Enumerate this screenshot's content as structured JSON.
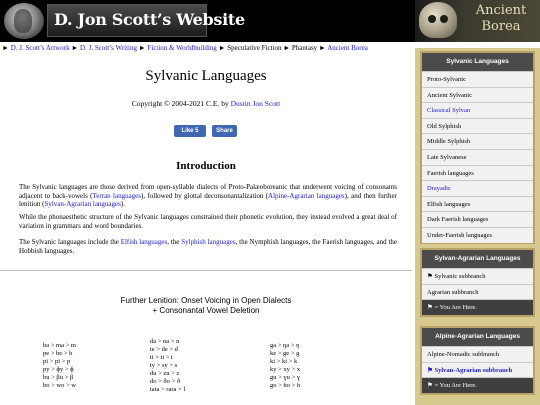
{
  "header": {
    "site_title": "D. Jon Scott’s Website",
    "banner_line1": "Ancient",
    "banner_line2": "Borea"
  },
  "breadcrumb": [
    {
      "label": "D. J. Scott’s Artwork",
      "link": true
    },
    {
      "label": "D. J. Scott’s Writing",
      "link": true
    },
    {
      "label": "Fiction & Worldbuilding",
      "link": true
    },
    {
      "label": "Speculative Fiction",
      "link": false
    },
    {
      "label": "Phantasy",
      "link": false
    },
    {
      "label": "Ancient Borea",
      "link": true
    }
  ],
  "main": {
    "title": "Sylvanic Languages",
    "copyright_prefix": "Copyright © 2004-2021 C.E. by",
    "copyright_author": "Dustin Jon Scott",
    "fb_like": "Like 5",
    "fb_share": "Share",
    "intro_heading": "Introduction",
    "p1": {
      "t1": "The Sylvanic languages are those derived from open-syllable dialects of Proto-Palæoboreanic that underwent voicing of consonants adjacent to back-vowels (",
      "l1": "Terran languages",
      "t2": "), followed by glottal deconsonantalization (",
      "l2": "Alpine-Agrarian languages",
      "t3": "), and then further lenition (",
      "l3": "Sylvan-Agrarian languages",
      "t4": ")."
    },
    "p2": "While the phonaesthetic structure of the Sylvanic languages constrained their phonetic evolution, they instead evolved a great deal of variation in grammars and word boundaries.",
    "p3": {
      "t1": "The Sylvanic languages include the ",
      "l1": "Elfish languages",
      "t2": ", the ",
      "l2": "Sylphish languages",
      "t3": ", the Nymphish languages, the Faerish languages, and the Hobbish languages."
    },
    "lenition_title_1": "Further Lenition: Onset Voicing in Open Dialects",
    "lenition_title_2": "+ Consonantal Vowel Deletion",
    "table_col1": [
      "ba > ma > m",
      "pe > be > b",
      "pi > pi > p",
      "py > ɸy > ɸ",
      "bu > βu > β",
      "bo > wo > w"
    ],
    "table_col2": [
      "da > na > n",
      "te > de > d",
      "ti > ti > t",
      "ty > sy > s",
      "du > zu > z",
      "do > ðo > ð",
      "tata > rara > l"
    ],
    "table_col3": [
      "ga > ŋa > ŋ",
      "ke > ge > g",
      "ki > ki > k",
      "ky > xy > x",
      "gu > ɣu > ɣ",
      "go > ɦo > ɦ"
    ]
  },
  "sidebar": {
    "sylvanic": {
      "header": "Sylvanic Languages",
      "items": [
        {
          "label": "Proto-Sylvanic",
          "style": "plain"
        },
        {
          "label": "Ancient Sylvanic",
          "style": "plain"
        },
        {
          "label": "Classical Sylvan",
          "style": "link"
        },
        {
          "label": "Old Sylphish",
          "style": "plain"
        },
        {
          "label": "Middle Sylphish",
          "style": "plain"
        },
        {
          "label": "Late Sylvanese",
          "style": "plain"
        },
        {
          "label": "Faerish languages",
          "style": "plain"
        },
        {
          "label": "Drayadic",
          "style": "link"
        },
        {
          "label": "Elfish languages",
          "style": "plain"
        },
        {
          "label": "Dark Faerish languages",
          "style": "plain"
        },
        {
          "label": "Under-Faerish languages",
          "style": "plain"
        }
      ]
    },
    "sylvan_agrarian": {
      "header": "Sylvan-Agrarian Languages",
      "items": [
        {
          "label": "⚑ Sylvanic subbranch",
          "style": "plain"
        },
        {
          "label": "Agrarian subbranch",
          "style": "plain"
        },
        {
          "label": "⚑ = You Are Here.",
          "style": "dark"
        }
      ]
    },
    "alpine_agrarian": {
      "header": "Alpine-Agrarian Languages",
      "items": [
        {
          "label": "Alpine-Nomadic subbranch",
          "style": "plain"
        },
        {
          "label": "⚑ Sylvan-Agrarian subbranch",
          "style": "bold-link"
        },
        {
          "label": "⚑ = You Are Here.",
          "style": "dark"
        }
      ]
    }
  }
}
